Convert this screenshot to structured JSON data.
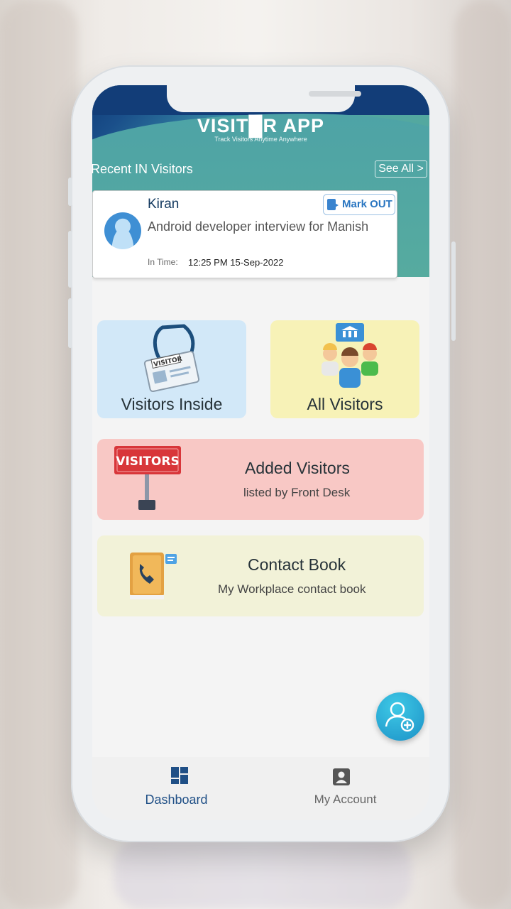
{
  "app": {
    "logo_title": "VISIT█R APP",
    "logo_subtitle": "Track Visitors Anytime Anywhere"
  },
  "recent": {
    "title": "Recent IN Visitors",
    "see_all": "See All >",
    "card": {
      "name": "Kiran",
      "purpose": "Android developer interview for Manish",
      "time_label": "In Time:",
      "time_value": "12:25 PM 15-Sep-2022",
      "mark_out_label": "Mark OUT"
    }
  },
  "tiles": {
    "visitors_inside": "Visitors Inside",
    "all_visitors": "All Visitors",
    "visitors_badge_text": "VISITOR",
    "added_visitors": {
      "title": "Added Visitors",
      "subtitle": "listed by Front Desk",
      "sign_text": "VISITORS"
    },
    "contact_book": {
      "title": "Contact Book",
      "subtitle": "My Workplace contact book"
    }
  },
  "bottom_nav": {
    "items": [
      {
        "label": "Dashboard",
        "icon": "dashboard-icon",
        "active": true
      },
      {
        "label": "My Account",
        "icon": "account-icon",
        "active": false
      }
    ]
  },
  "colors": {
    "header_dark": "#123d78",
    "header_teal": "#56ab9f",
    "accent_blue": "#1f4f86",
    "tile_blue": "#d2e8f8",
    "tile_yellow": "#f7f2b7",
    "tile_pink": "#f8c8c5",
    "tile_cream": "#f2f2d8"
  }
}
